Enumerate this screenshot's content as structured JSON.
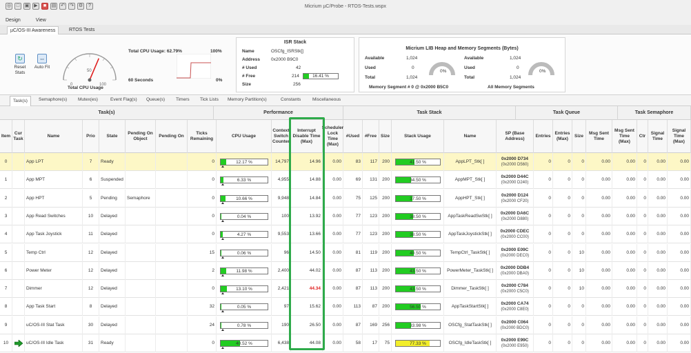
{
  "window": {
    "title": "Micrium µC/Probe - RTOS-Tests.wspx"
  },
  "menu": [
    "Design",
    "View"
  ],
  "ribbon_tabs": [
    "µC/OS-III Awareness",
    "RTOS Tests"
  ],
  "ribbon": {
    "reset_stats": "Reset Stats",
    "auto_fit": "Auto Fit",
    "gauge_ticks": {
      "zero": "0",
      "fifty": "50",
      "hundred": "100"
    },
    "gauge_value": 62.79,
    "total_cpu_usage_label": "Total CPU Usage",
    "total_cpu_usage_title": "Total CPU Usage: 62.79%",
    "trend_max": "100%",
    "trend_min": "0%",
    "trend_window": "60 Seconds",
    "isr": {
      "title": "ISR Stack",
      "name_label": "Name",
      "name_value": "OSCfg_ISRStk[]",
      "address_label": "Address",
      "address_value": "0x2000 B9C0",
      "used_label": "# Used",
      "used_value": "42",
      "free_label": "# Free",
      "free_value": "214",
      "free_pct": "16.41 %",
      "free_fraction": 0.1641,
      "size_label": "Size",
      "size_value": "256"
    },
    "heap": {
      "title": "Micrium LIB Heap and Memory Segments (Bytes)",
      "left": {
        "available_label": "Available",
        "available_value": "1,024",
        "used_label": "Used",
        "used_value": "0",
        "total_label": "Total",
        "total_value": "1,024",
        "pct": "0%",
        "caption": "Memory Segment # 0 @ 0x2000 B5C0"
      },
      "right": {
        "available_label": "Available",
        "available_value": "1,024",
        "used_label": "Used",
        "used_value": "0",
        "total_label": "Total",
        "total_value": "1,024",
        "pct": "0%",
        "caption": "All Memory Segments"
      }
    }
  },
  "subtabs": [
    "Task(s)",
    "Semaphore(s)",
    "Mutex(es)",
    "Event Flag(s)",
    "Queue(s)",
    "Timers",
    "Tick Lists",
    "Memory Partition(s)",
    "Constants",
    "Miscellaneous"
  ],
  "groups": {
    "tasks": "Task(s)",
    "performance": "Performance",
    "task_stack": "Task Stack",
    "task_queue": "Task Queue",
    "task_semaphore": "Task Semaphore"
  },
  "columns": [
    "Item",
    "Cur Task",
    "Name",
    "Prio",
    "State",
    "Pending On Object",
    "Pending On",
    "Ticks Remaining",
    "CPU Usage",
    "Context Switch Counter",
    "Interrupt Disable Time (Max)",
    "Scheduler Lock Time (Max)",
    "#Used",
    "#Free",
    "Size",
    "Stack Usage",
    "Name",
    "SP (Base Address)",
    "Entries",
    "Entries (Max)",
    "Size",
    "Msg Sent Time",
    "Msg Sent Time (Max)",
    "Ctr",
    "Signal Time",
    "Signal Time (Max)"
  ],
  "rows": [
    {
      "item": "0",
      "cur": "",
      "name": "App LPT",
      "prio": "7",
      "state": "Ready",
      "pobj": "",
      "pon": "",
      "ticks": "0",
      "cpu": 12.17,
      "cpu_text": "12.17 %",
      "ctx": "14,797",
      "idis": "14.96",
      "idis_red": false,
      "slock": "0.00",
      "used": "83",
      "free": "117",
      "size": "200",
      "stk": 41.5,
      "stk_text": "41.50 %",
      "stk_yellow": false,
      "sname": "AppLPT_Stk[ ]",
      "sp_a": "0x2000 D734",
      "sp_b": "(0x2000 D560)",
      "qe": "0",
      "qem": "0",
      "qs": "0",
      "mst": "0.00",
      "mstm": "0.00",
      "ctr": "0",
      "sig": "0.00",
      "sigm": "0.00"
    },
    {
      "item": "1",
      "cur": "",
      "name": "App MPT",
      "prio": "6",
      "state": "Suspended",
      "pobj": "",
      "pon": "",
      "ticks": "0",
      "cpu": 6.33,
      "cpu_text": "6.33 %",
      "ctx": "4,955",
      "idis": "14.88",
      "idis_red": false,
      "slock": "0.00",
      "used": "69",
      "free": "131",
      "size": "200",
      "stk": 34.5,
      "stk_text": "34.50 %",
      "stk_yellow": false,
      "sname": "AppMPT_Stk[ ]",
      "sp_a": "0x2000 D44C",
      "sp_b": "(0x2000 D240)",
      "qe": "0",
      "qem": "0",
      "qs": "0",
      "mst": "0.00",
      "mstm": "0.00",
      "ctr": "0",
      "sig": "0.00",
      "sigm": "0.00"
    },
    {
      "item": "2",
      "cur": "",
      "name": "App HPT",
      "prio": "5",
      "state": "Pending",
      "pobj": "Semaphore",
      "pon": "",
      "ticks": "0",
      "cpu": 10.66,
      "cpu_text": "10.66 %",
      "ctx": "9,948",
      "idis": "14.84",
      "idis_red": false,
      "slock": "0.00",
      "used": "75",
      "free": "125",
      "size": "200",
      "stk": 37.5,
      "stk_text": "37.50 %",
      "stk_yellow": false,
      "sname": "AppHPT_Stk[ ]",
      "sp_a": "0x2000 D124",
      "sp_b": "(0x2000 CF20)",
      "qe": "0",
      "qem": "0",
      "qs": "0",
      "mst": "0.00",
      "mstm": "0.00",
      "ctr": "0",
      "sig": "0.00",
      "sigm": "0.00"
    },
    {
      "item": "3",
      "cur": "",
      "name": "App Read Switches",
      "prio": "10",
      "state": "Delayed",
      "pobj": "",
      "pon": "",
      "ticks": "0",
      "cpu": 0.04,
      "cpu_text": "0.04 %",
      "ctx": "100",
      "idis": "13.92",
      "idis_red": false,
      "slock": "0.00",
      "used": "77",
      "free": "123",
      "size": "200",
      "stk": 38.5,
      "stk_text": "38.50 %",
      "stk_yellow": false,
      "sname": "AppTaskReadSwStk[ ]",
      "sp_a": "0x2000 DA6C",
      "sp_b": "(0x2000 D880)",
      "qe": "0",
      "qem": "0",
      "qs": "0",
      "mst": "0.00",
      "mstm": "0.00",
      "ctr": "0",
      "sig": "0.00",
      "sigm": "0.00"
    },
    {
      "item": "4",
      "cur": "",
      "name": "App Task Joystick",
      "prio": "11",
      "state": "Delayed",
      "pobj": "",
      "pon": "",
      "ticks": "0",
      "cpu": 4.27,
      "cpu_text": "4.27 %",
      "ctx": "9,553",
      "idis": "13.66",
      "idis_red": false,
      "slock": "0.00",
      "used": "77",
      "free": "123",
      "size": "200",
      "stk": 38.5,
      "stk_text": "38.50 %",
      "stk_yellow": false,
      "sname": "AppTaskJoystickStk[ ]",
      "sp_a": "0x2000 CDEC",
      "sp_b": "(0x2000 CC00)",
      "qe": "0",
      "qem": "0",
      "qs": "0",
      "mst": "0.00",
      "mstm": "0.00",
      "ctr": "0",
      "sig": "0.00",
      "sigm": "0.00"
    },
    {
      "item": "5",
      "cur": "",
      "name": "Temp Ctrl",
      "prio": "12",
      "state": "Delayed",
      "pobj": "",
      "pon": "",
      "ticks": "15",
      "cpu": 0.06,
      "cpu_text": "0.06 %",
      "ctx": "96",
      "idis": "14.50",
      "idis_red": false,
      "slock": "0.00",
      "used": "81",
      "free": "119",
      "size": "200",
      "stk": 40.5,
      "stk_text": "40.50 %",
      "stk_yellow": false,
      "sname": "TempCtrl_TaskStk[ ]",
      "sp_a": "0x2000 E09C",
      "sp_b": "(0x2000 DEC0)",
      "qe": "0",
      "qem": "0",
      "qs": "10",
      "mst": "0.00",
      "mstm": "0.00",
      "ctr": "0",
      "sig": "0.00",
      "sigm": "0.00"
    },
    {
      "item": "6",
      "cur": "",
      "name": "Power Meter",
      "prio": "12",
      "state": "Delayed",
      "pobj": "",
      "pon": "",
      "ticks": "2",
      "cpu": 11.98,
      "cpu_text": "11.98 %",
      "ctx": "2,400",
      "idis": "44.02",
      "idis_red": false,
      "slock": "0.00",
      "used": "87",
      "free": "113",
      "size": "200",
      "stk": 43.5,
      "stk_text": "43.50 %",
      "stk_yellow": false,
      "sname": "PowerMeter_TaskStk[ ]",
      "sp_a": "0x2000 DDB4",
      "sp_b": "(0x2000 DBA0)",
      "qe": "0",
      "qem": "0",
      "qs": "10",
      "mst": "0.00",
      "mstm": "0.00",
      "ctr": "0",
      "sig": "0.00",
      "sigm": "0.00"
    },
    {
      "item": "7",
      "cur": "",
      "name": "Dimmer",
      "prio": "12",
      "state": "Delayed",
      "pobj": "",
      "pon": "",
      "ticks": "0",
      "cpu": 13.1,
      "cpu_text": "13.10 %",
      "ctx": "2,421",
      "idis": "44.34",
      "idis_red": true,
      "slock": "0.00",
      "used": "87",
      "free": "113",
      "size": "200",
      "stk": 43.5,
      "stk_text": "43.50 %",
      "stk_yellow": false,
      "sname": "Dimmer_TaskStk[ ]",
      "sp_a": "0x2000 C784",
      "sp_b": "(0x2000 C5C0)",
      "qe": "0",
      "qem": "0",
      "qs": "10",
      "mst": "0.00",
      "mstm": "0.00",
      "ctr": "0",
      "sig": "0.00",
      "sigm": "0.00"
    },
    {
      "item": "8",
      "cur": "",
      "name": "App Task Start",
      "prio": "8",
      "state": "Delayed",
      "pobj": "",
      "pon": "",
      "ticks": "32",
      "cpu": 0.05,
      "cpu_text": "0.05 %",
      "ctx": "97",
      "idis": "15.62",
      "idis_red": false,
      "slock": "0.00",
      "used": "113",
      "free": "87",
      "size": "200",
      "stk": 56.5,
      "stk_text": "56.50 %",
      "stk_yellow": false,
      "sname": "AppTaskStartStk[ ]",
      "sp_a": "0x2000 CA74",
      "sp_b": "(0x2000 C8E0)",
      "qe": "0",
      "qem": "0",
      "qs": "0",
      "mst": "0.00",
      "mstm": "0.00",
      "ctr": "0",
      "sig": "0.00",
      "sigm": "0.00"
    },
    {
      "item": "9",
      "cur": "",
      "name": "uC/OS-III Stat Task",
      "prio": "30",
      "state": "Delayed",
      "pobj": "",
      "pon": "",
      "ticks": "24",
      "cpu": 0.78,
      "cpu_text": "0.78 %",
      "ctx": "190",
      "idis": "26.50",
      "idis_red": false,
      "slock": "0.00",
      "used": "87",
      "free": "169",
      "size": "256",
      "stk": 33.98,
      "stk_text": "33.98 %",
      "stk_yellow": false,
      "sname": "OSCfg_StatTaskStk[ ]",
      "sp_a": "0x2000 C064",
      "sp_b": "(0x2000 BDC0)",
      "qe": "0",
      "qem": "0",
      "qs": "0",
      "mst": "0.00",
      "mstm": "0.00",
      "ctr": "0",
      "sig": "0.00",
      "sigm": "0.00"
    },
    {
      "item": "10",
      "cur": "arrow",
      "name": "uC/OS-III Idle Task",
      "prio": "31",
      "state": "Ready",
      "pobj": "",
      "pon": "",
      "ticks": "0",
      "cpu": 40.52,
      "cpu_text": "40.52 %",
      "ctx": "6,438",
      "idis": "44.08",
      "idis_red": false,
      "slock": "0.00",
      "used": "58",
      "free": "17",
      "size": "75",
      "stk": 77.33,
      "stk_text": "77.33 %",
      "stk_yellow": true,
      "sname": "OSCfg_IdleTaskStk[ ]",
      "sp_a": "0x2000 E99C",
      "sp_b": "(0x2000 E950)",
      "qe": "0",
      "qem": "0",
      "qs": "0",
      "mst": "0.00",
      "mstm": "0.00",
      "ctr": "0",
      "sig": "0.00",
      "sigm": "0.00"
    }
  ],
  "colors": {
    "green_bar": "#22cc22",
    "yellow_bar": "#f2ee2a",
    "highlight": "#2eaa4a",
    "selected_row": "#fdf7c6"
  }
}
